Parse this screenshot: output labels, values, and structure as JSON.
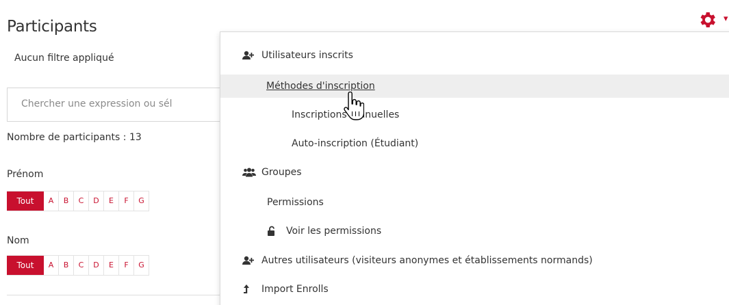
{
  "page": {
    "title": "Participants",
    "filter_status": "Aucun filtre appliqué",
    "search_placeholder": "Chercher une expression ou sél",
    "participant_count": "Nombre de participants : 13"
  },
  "first_name_bar": {
    "label": "Prénom",
    "all_label": "Tout",
    "letters": [
      "A",
      "B",
      "C",
      "D",
      "E",
      "F",
      "G"
    ]
  },
  "last_name_bar": {
    "label": "Nom",
    "all_label": "Tout",
    "letters": [
      "A",
      "B",
      "C",
      "D",
      "E",
      "F",
      "G"
    ]
  },
  "settings": {
    "icon": "gear-icon",
    "accent_color": "#c8102e"
  },
  "menu": {
    "enrolled_users": "Utilisateurs inscrits",
    "enrolment_methods": "Méthodes d'inscription",
    "manual_enrolments": "Inscriptions manuelles",
    "self_enrolment": "Auto-inscription (Étudiant)",
    "groups": "Groupes",
    "permissions": "Permissions",
    "check_permissions": "Voir les permissions",
    "other_users": "Autres utilisateurs (visiteurs anonymes et établissements normands)",
    "import_enrolls": "Import Enrolls"
  }
}
